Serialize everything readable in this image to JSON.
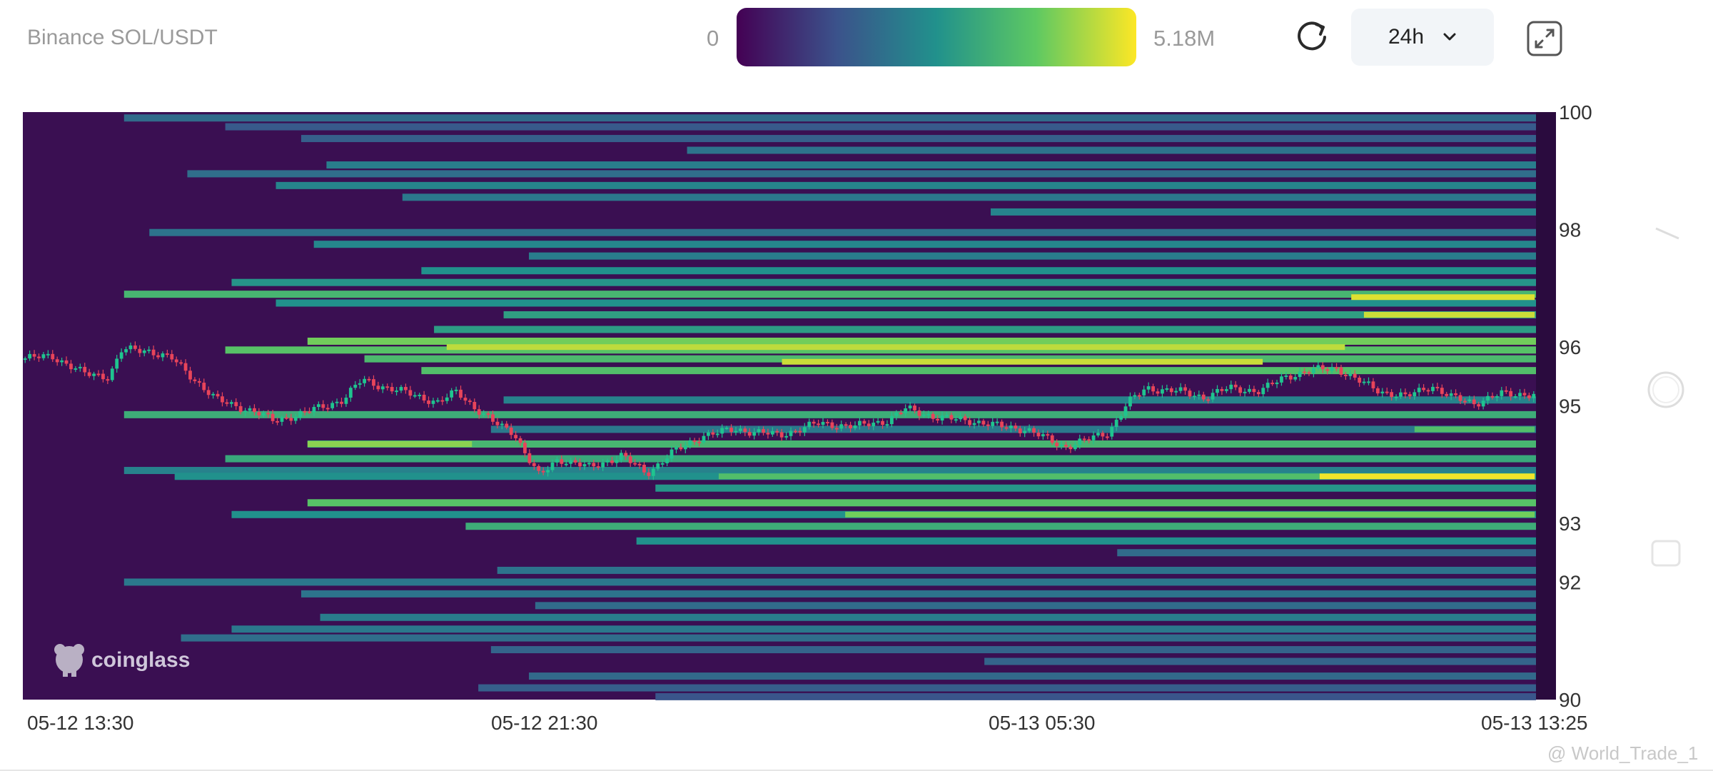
{
  "header": {
    "title": "Binance SOL/USDT",
    "colorbar_min": "0",
    "colorbar_max": "5.18M",
    "period": "24h"
  },
  "colors": {
    "plot_background": "#3a0f52",
    "candle_up": "#1fc48f",
    "candle_down": "#e8445a",
    "colormap": [
      "#440154",
      "#3b528b",
      "#21918c",
      "#5ec962",
      "#fde725"
    ]
  },
  "icons": {
    "refresh": "refresh-icon",
    "dropdown": "chevron-down-icon",
    "expand": "expand-icon"
  },
  "chart_data": {
    "type": "heatmap",
    "title": "Binance SOL/USDT",
    "description_series": "liquidation heatmap with candlestick price",
    "x_ticks": [
      "05-12 13:30",
      "05-12 21:30",
      "05-13 05:30",
      "05-13 13:25"
    ],
    "y_ticks": [
      100,
      98,
      96,
      95,
      93,
      92,
      90
    ],
    "ylim": [
      90,
      100
    ],
    "xlim_hours": [
      0,
      23.92
    ],
    "colorbar": {
      "min": 0,
      "max": 5180000,
      "min_label": "0",
      "max_label": "5.18M"
    },
    "bands": [
      {
        "p": 99.9,
        "s": 1.6,
        "v": 0.35
      },
      {
        "p": 99.75,
        "s": 3.2,
        "v": 0.28
      },
      {
        "p": 99.55,
        "s": 4.4,
        "v": 0.3
      },
      {
        "p": 99.35,
        "s": 10.5,
        "v": 0.38
      },
      {
        "p": 99.1,
        "s": 4.8,
        "v": 0.42
      },
      {
        "p": 98.95,
        "s": 2.6,
        "v": 0.36
      },
      {
        "p": 98.75,
        "s": 4.0,
        "v": 0.45
      },
      {
        "p": 98.55,
        "s": 6.0,
        "v": 0.4
      },
      {
        "p": 98.3,
        "s": 15.3,
        "v": 0.45
      },
      {
        "p": 97.95,
        "s": 2.0,
        "v": 0.38
      },
      {
        "p": 97.75,
        "s": 4.6,
        "v": 0.46
      },
      {
        "p": 97.55,
        "s": 8.0,
        "v": 0.42
      },
      {
        "p": 97.3,
        "s": 6.3,
        "v": 0.5
      },
      {
        "p": 97.1,
        "s": 3.3,
        "v": 0.52
      },
      {
        "p": 96.9,
        "s": 1.6,
        "v": 0.66
      },
      {
        "p": 96.75,
        "s": 4.0,
        "v": 0.5
      },
      {
        "p": 96.55,
        "s": 7.6,
        "v": 0.56
      },
      {
        "p": 96.3,
        "s": 6.5,
        "v": 0.55
      },
      {
        "p": 96.1,
        "s": 4.5,
        "v": 0.78
      },
      {
        "p": 95.95,
        "s": 3.2,
        "v": 0.72
      },
      {
        "p": 95.8,
        "s": 5.4,
        "v": 0.68
      },
      {
        "p": 95.6,
        "s": 6.3,
        "v": 0.7
      },
      {
        "p": 95.1,
        "s": 7.6,
        "v": 0.44
      },
      {
        "p": 94.85,
        "s": 1.6,
        "v": 0.62
      },
      {
        "p": 94.6,
        "s": 7.4,
        "v": 0.4
      },
      {
        "p": 94.35,
        "s": 4.5,
        "v": 0.66
      },
      {
        "p": 94.1,
        "s": 3.2,
        "v": 0.6
      },
      {
        "p": 93.9,
        "s": 1.6,
        "v": 0.44
      },
      {
        "p": 93.8,
        "s": 2.4,
        "v": 0.5
      },
      {
        "p": 93.6,
        "s": 10.0,
        "v": 0.52
      },
      {
        "p": 93.35,
        "s": 4.5,
        "v": 0.72
      },
      {
        "p": 93.15,
        "s": 3.3,
        "v": 0.5
      },
      {
        "p": 92.95,
        "s": 7.0,
        "v": 0.62
      },
      {
        "p": 92.7,
        "s": 9.7,
        "v": 0.5
      },
      {
        "p": 92.5,
        "s": 17.3,
        "v": 0.35
      },
      {
        "p": 92.2,
        "s": 7.5,
        "v": 0.38
      },
      {
        "p": 92.0,
        "s": 1.6,
        "v": 0.4
      },
      {
        "p": 91.8,
        "s": 4.4,
        "v": 0.38
      },
      {
        "p": 91.6,
        "s": 8.1,
        "v": 0.35
      },
      {
        "p": 91.4,
        "s": 4.7,
        "v": 0.42
      },
      {
        "p": 91.2,
        "s": 3.3,
        "v": 0.4
      },
      {
        "p": 91.05,
        "s": 2.5,
        "v": 0.36
      },
      {
        "p": 90.85,
        "s": 7.4,
        "v": 0.32
      },
      {
        "p": 90.65,
        "s": 15.2,
        "v": 0.32
      },
      {
        "p": 90.4,
        "s": 8.0,
        "v": 0.34
      },
      {
        "p": 90.2,
        "s": 7.2,
        "v": 0.3
      },
      {
        "p": 90.05,
        "s": 10.0,
        "v": 0.26
      }
    ],
    "highlights": [
      {
        "p": 96.85,
        "s": 21.0,
        "e": 23.9,
        "v": 0.95
      },
      {
        "p": 96.55,
        "s": 21.2,
        "e": 23.9,
        "v": 0.92
      },
      {
        "p": 96.0,
        "s": 6.7,
        "e": 20.9,
        "v": 0.9
      },
      {
        "p": 95.75,
        "s": 12.0,
        "e": 19.6,
        "v": 0.92
      },
      {
        "p": 93.8,
        "s": 11.0,
        "e": 23.9,
        "v": 0.7
      },
      {
        "p": 93.8,
        "s": 20.5,
        "e": 23.9,
        "v": 0.98
      },
      {
        "p": 94.35,
        "s": 4.5,
        "e": 7.1,
        "v": 0.82
      },
      {
        "p": 93.15,
        "s": 13.0,
        "e": 23.9,
        "v": 0.78
      },
      {
        "p": 94.6,
        "s": 22.0,
        "e": 23.9,
        "v": 0.7
      }
    ],
    "price": [
      {
        "t": 0.0,
        "p": 95.8
      },
      {
        "t": 0.5,
        "p": 95.85
      },
      {
        "t": 1.0,
        "p": 95.55
      },
      {
        "t": 1.4,
        "p": 95.5
      },
      {
        "t": 1.6,
        "p": 95.95
      },
      {
        "t": 2.0,
        "p": 95.95
      },
      {
        "t": 2.4,
        "p": 95.8
      },
      {
        "t": 2.8,
        "p": 95.4
      },
      {
        "t": 3.1,
        "p": 95.1
      },
      {
        "t": 3.4,
        "p": 95.0
      },
      {
        "t": 3.7,
        "p": 94.9
      },
      {
        "t": 4.0,
        "p": 94.75
      },
      {
        "t": 4.4,
        "p": 94.85
      },
      {
        "t": 4.8,
        "p": 95.0
      },
      {
        "t": 5.1,
        "p": 95.1
      },
      {
        "t": 5.4,
        "p": 95.45
      },
      {
        "t": 5.8,
        "p": 95.3
      },
      {
        "t": 6.2,
        "p": 95.2
      },
      {
        "t": 6.6,
        "p": 95.05
      },
      {
        "t": 6.9,
        "p": 95.25
      },
      {
        "t": 7.2,
        "p": 94.95
      },
      {
        "t": 7.5,
        "p": 94.7
      },
      {
        "t": 7.8,
        "p": 94.55
      },
      {
        "t": 8.0,
        "p": 94.15
      },
      {
        "t": 8.2,
        "p": 93.8
      },
      {
        "t": 8.5,
        "p": 94.1
      },
      {
        "t": 9.0,
        "p": 93.95
      },
      {
        "t": 9.5,
        "p": 94.15
      },
      {
        "t": 9.9,
        "p": 93.85
      },
      {
        "t": 10.3,
        "p": 94.2
      },
      {
        "t": 10.8,
        "p": 94.5
      },
      {
        "t": 11.3,
        "p": 94.6
      },
      {
        "t": 12.0,
        "p": 94.5
      },
      {
        "t": 12.6,
        "p": 94.7
      },
      {
        "t": 13.2,
        "p": 94.65
      },
      {
        "t": 13.7,
        "p": 94.75
      },
      {
        "t": 14.0,
        "p": 94.95
      },
      {
        "t": 14.5,
        "p": 94.8
      },
      {
        "t": 15.0,
        "p": 94.75
      },
      {
        "t": 15.5,
        "p": 94.65
      },
      {
        "t": 15.9,
        "p": 94.6
      },
      {
        "t": 16.2,
        "p": 94.45
      },
      {
        "t": 16.5,
        "p": 94.3
      },
      {
        "t": 16.8,
        "p": 94.4
      },
      {
        "t": 17.2,
        "p": 94.55
      },
      {
        "t": 17.5,
        "p": 95.05
      },
      {
        "t": 17.8,
        "p": 95.3
      },
      {
        "t": 18.3,
        "p": 95.25
      },
      {
        "t": 18.7,
        "p": 95.15
      },
      {
        "t": 19.1,
        "p": 95.3
      },
      {
        "t": 19.6,
        "p": 95.25
      },
      {
        "t": 20.0,
        "p": 95.5
      },
      {
        "t": 20.4,
        "p": 95.6
      },
      {
        "t": 20.8,
        "p": 95.65
      },
      {
        "t": 21.1,
        "p": 95.45
      },
      {
        "t": 21.5,
        "p": 95.25
      },
      {
        "t": 21.9,
        "p": 95.15
      },
      {
        "t": 22.3,
        "p": 95.35
      },
      {
        "t": 22.6,
        "p": 95.15
      },
      {
        "t": 23.0,
        "p": 95.05
      },
      {
        "t": 23.4,
        "p": 95.2
      },
      {
        "t": 23.9,
        "p": 95.2
      }
    ]
  },
  "watermark": {
    "brand": "coinglass",
    "user": "@ World_Trade_1"
  }
}
